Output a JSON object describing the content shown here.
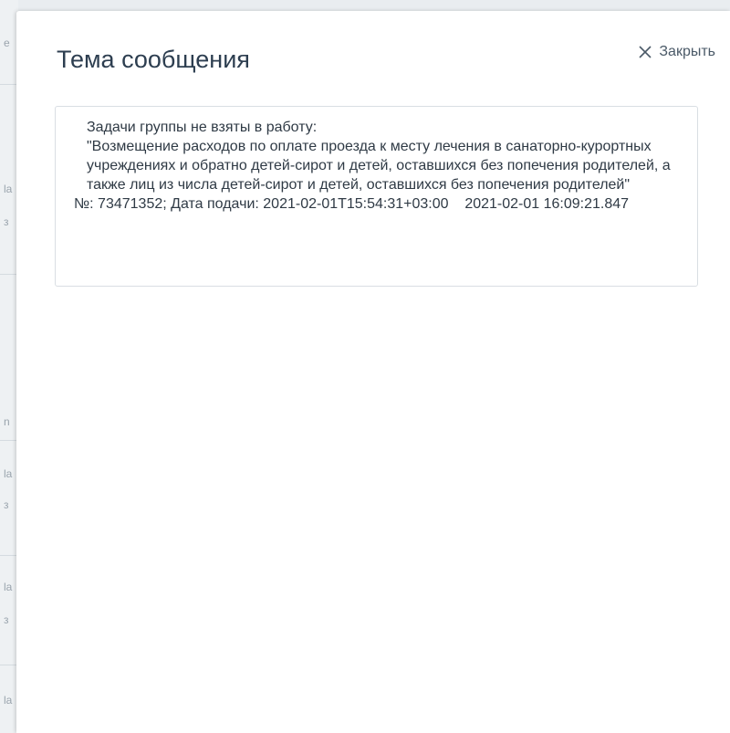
{
  "dialog": {
    "title": "Тема сообщения",
    "close_label": "Закрыть"
  },
  "message": {
    "heading": "Задачи группы не взяты в работу:",
    "body": "\"Возмещение расходов по оплате проезда к месту лечения в санаторно-курортных учреждениях и обратно детей-сирот и детей, оставшихся без попечения родителей, а также лиц из числа детей-сирот и детей, оставшихся без попечения родителей\"",
    "meta": "№: 73471352; Дата подачи: 2021-02-01T15:54:31+03:00    2021-02-01 16:09:21.847"
  },
  "background": {
    "glyphs": [
      "e",
      "la",
      "з",
      "n",
      "la",
      "з",
      "la",
      "з",
      "la"
    ]
  },
  "colors": {
    "title": "#2d3e50",
    "text": "#2f3a45",
    "border": "#d9dee3"
  }
}
